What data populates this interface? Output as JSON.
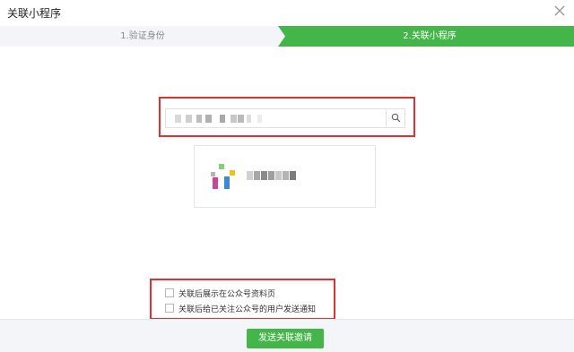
{
  "dialog": {
    "title": "关联小程序",
    "close_icon": "close-icon"
  },
  "steps": [
    {
      "label": "1.验证身份",
      "active": false
    },
    {
      "label": "2.关联小程序",
      "active": true
    }
  ],
  "search": {
    "value": "",
    "placeholder": "",
    "icon": "search-icon"
  },
  "result_card": {
    "logo_icon": "mini-program-logo",
    "name": ""
  },
  "options": [
    {
      "label": "关联后展示在公众号资料页",
      "checked": false
    },
    {
      "label": "关联后给已关注公众号的用户发送通知",
      "checked": false
    }
  ],
  "footer": {
    "send_label": "发送关联邀请"
  },
  "colors": {
    "accent": "#44b549",
    "highlight": "#e03131",
    "step_bg": "#f4f5f9"
  }
}
